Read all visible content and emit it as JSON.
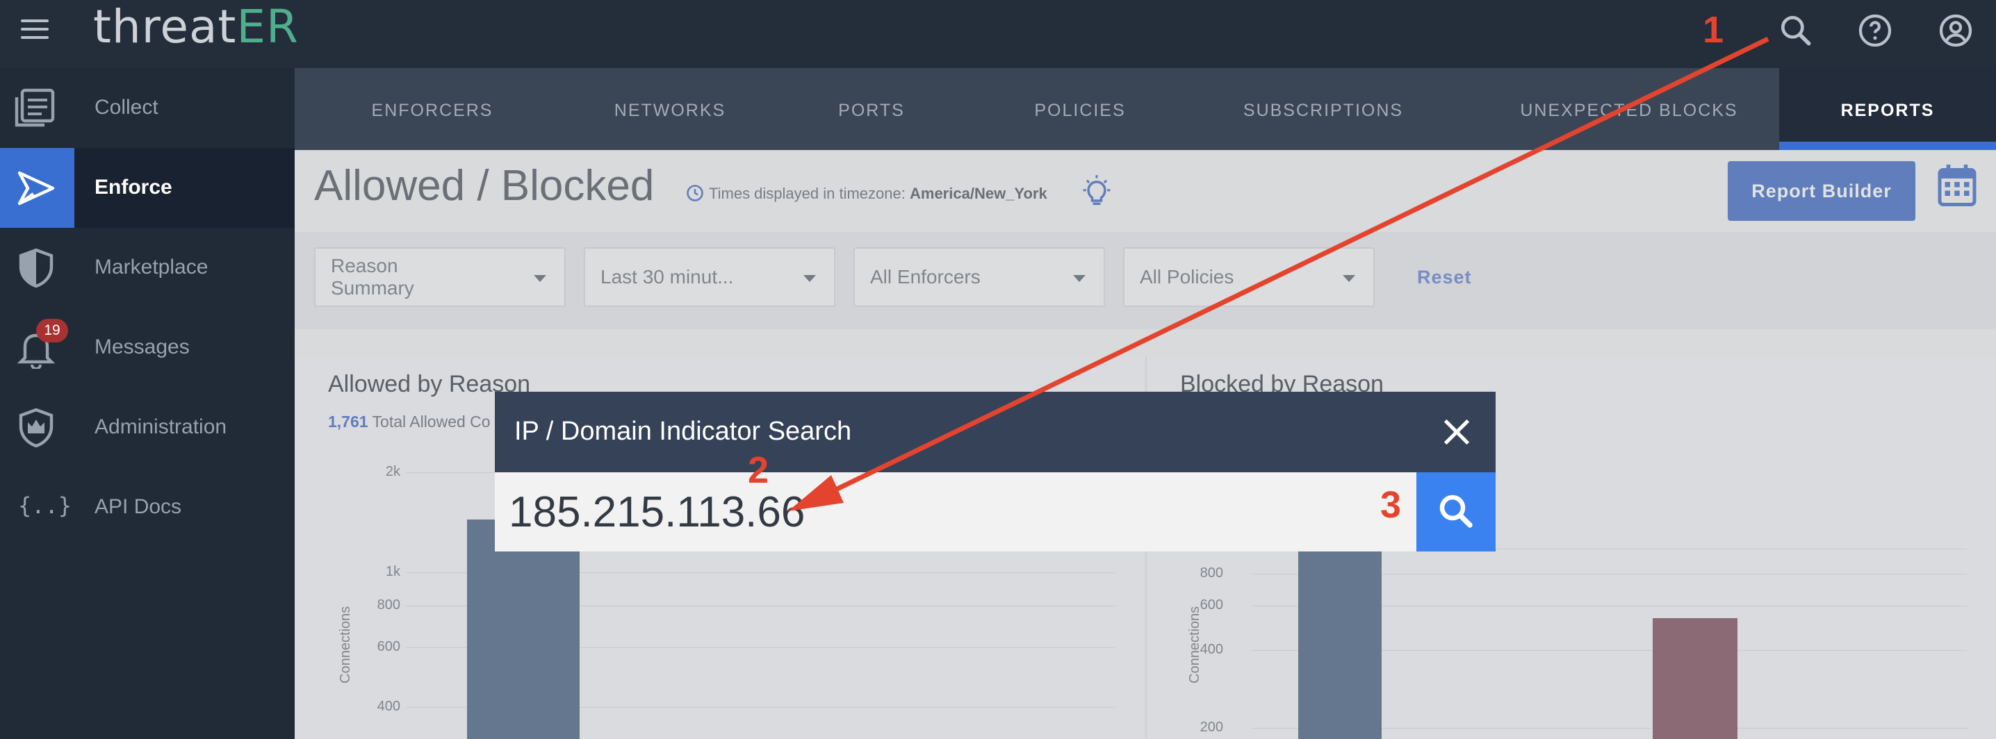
{
  "app": {
    "logo_text": "threatER",
    "logo_main": "threat",
    "logo_accent": "ER"
  },
  "sidebar": {
    "items": [
      {
        "label": "Collect",
        "icon": "collect-icon"
      },
      {
        "label": "Enforce",
        "icon": "enforce-icon",
        "active": true
      },
      {
        "label": "Marketplace",
        "icon": "shield-icon"
      },
      {
        "label": "Messages",
        "icon": "bell-icon",
        "badge": "19"
      },
      {
        "label": "Administration",
        "icon": "crown-shield-icon"
      },
      {
        "label": "API Docs",
        "icon": "braces-icon",
        "glyph": "{..}"
      }
    ]
  },
  "tabs": [
    {
      "label": "ENFORCERS"
    },
    {
      "label": "NETWORKS"
    },
    {
      "label": "PORTS"
    },
    {
      "label": "POLICIES"
    },
    {
      "label": "SUBSCRIPTIONS"
    },
    {
      "label": "UNEXPECTED BLOCKS"
    },
    {
      "label": "REPORTS",
      "active": true
    }
  ],
  "page": {
    "title": "Allowed / Blocked",
    "tz_prefix": "Times displayed in timezone:",
    "tz_value": "America/New_York",
    "report_builder": "Report Builder"
  },
  "filters": {
    "reason": "Reason Summary",
    "time": "Last 30 minut...",
    "enforcers": "All Enforcers",
    "policies": "All Policies",
    "reset": "Reset"
  },
  "allowed_panel": {
    "title": "Allowed by Reason",
    "total_count": "1,761",
    "total_label": "Total Allowed Co",
    "ylabel": "Connections",
    "ticks": [
      "2k",
      "1k",
      "800",
      "600",
      "400"
    ]
  },
  "blocked_panel": {
    "title": "Blocked by Reason",
    "ylabel": "Connections",
    "ticks": [
      "800",
      "600",
      "400",
      "200"
    ]
  },
  "modal": {
    "title": "IP / Domain Indicator Search",
    "value": "185.215.113.66"
  },
  "annotations": {
    "one": "1",
    "two": "2",
    "three": "3"
  },
  "colors": {
    "accent": "#3a6fd2",
    "annotation": "#e4442e",
    "bar_allowed": "#41597e",
    "bar_blocked": "#7b4556"
  }
}
